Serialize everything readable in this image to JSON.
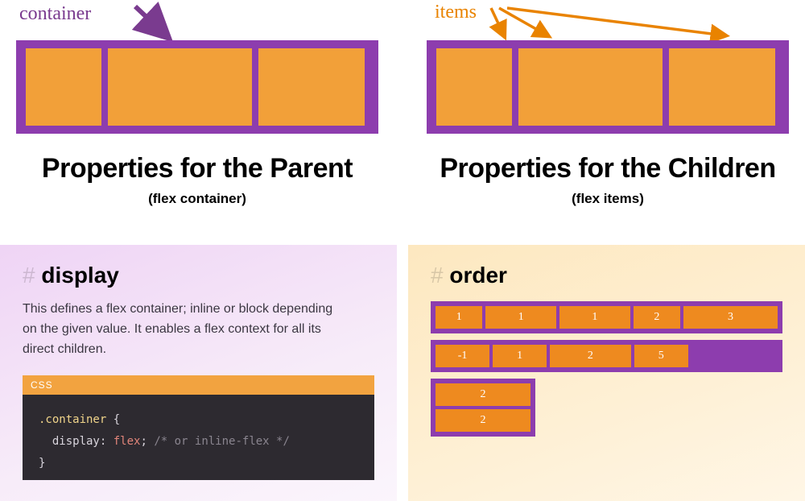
{
  "top": {
    "container_label": "container",
    "items_label": "items"
  },
  "parent": {
    "heading": "Properties for the Parent",
    "subheading": "(flex container)"
  },
  "children": {
    "heading": "Properties for the Children",
    "subheading": "(flex items)"
  },
  "display_section": {
    "title": "display",
    "description": "This defines a flex container; inline or block depending on the given value. It enables a flex context for all its direct children.",
    "code_lang": "CSS",
    "code": {
      "selector": ".container",
      "property": "display",
      "value": "flex",
      "comment": "/* or inline-flex */"
    }
  },
  "order_section": {
    "title": "order",
    "rows": [
      {
        "type": "full",
        "cells": [
          "1",
          "1",
          "1",
          "2",
          "3"
        ],
        "widths": [
          "w1",
          "w1-5",
          "w1-5",
          "w1",
          "w2"
        ]
      },
      {
        "type": "partial",
        "cells": [
          "-1",
          "1",
          "2",
          "5"
        ],
        "widths": [
          "w1",
          "w1",
          "w1-5",
          "w1"
        ]
      },
      {
        "type": "narrow",
        "cells": [
          "2",
          "2"
        ]
      }
    ]
  },
  "colors": {
    "purple": "#8d3dae",
    "orange": "#f2a039",
    "label_purple": "#7a3b8f",
    "label_orange": "#e98300"
  }
}
